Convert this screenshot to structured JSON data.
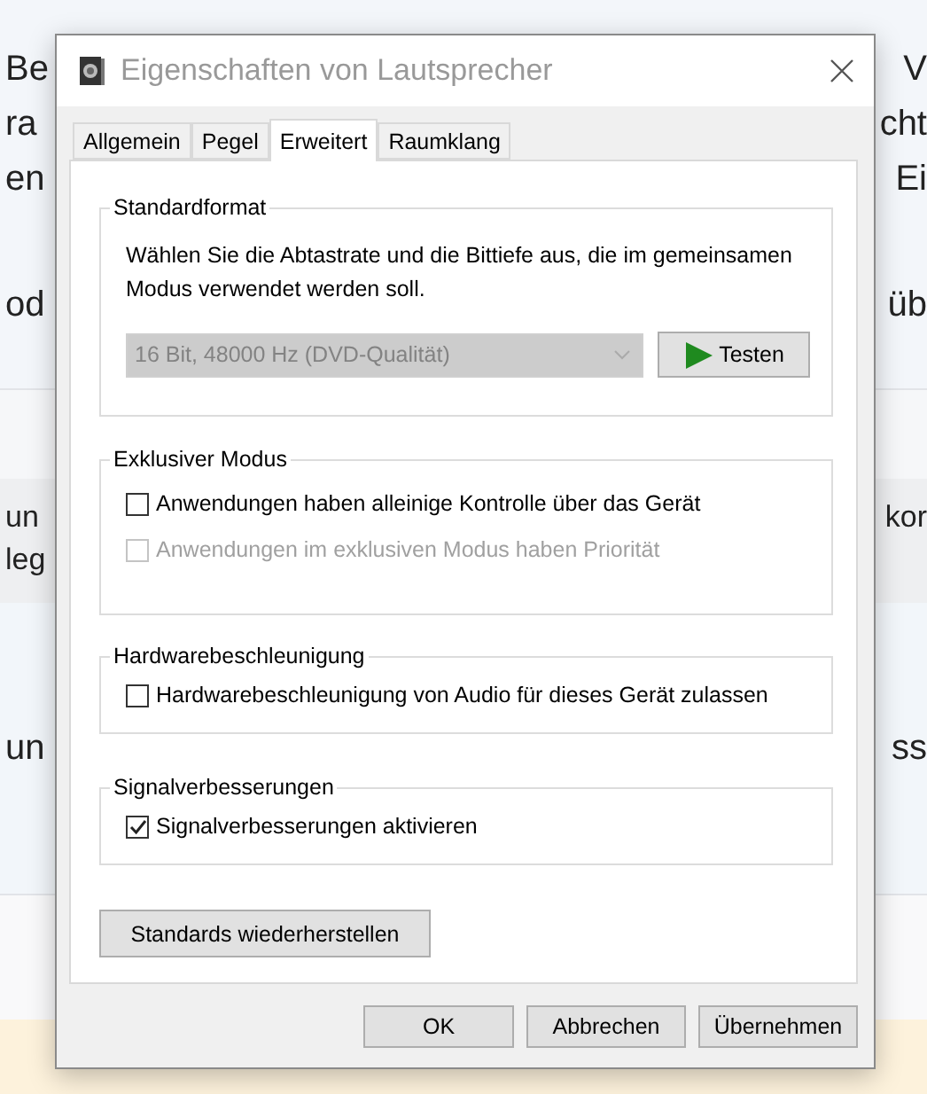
{
  "background": {
    "sections": [
      {
        "kind": "intro",
        "lines": [
          {
            "left": "Be",
            "right": "V"
          },
          {
            "left": "ra",
            "right": "cht"
          },
          {
            "left": "en",
            "right": "Ei"
          }
        ]
      },
      {
        "kind": "intro",
        "lines": [
          {
            "left": "od",
            "right": "üb"
          }
        ]
      },
      {
        "kind": "bar"
      },
      {
        "kind": "highlight",
        "lines": [
          {
            "left": "un",
            "right": "kor"
          },
          {
            "left": "leg"
          }
        ]
      },
      {
        "kind": "body",
        "lines": [
          {
            "left": "un",
            "right": "ss"
          }
        ]
      },
      {
        "kind": "footer"
      },
      {
        "kind": "notice"
      }
    ]
  },
  "window": {
    "title": "Eigenschaften von Lautsprecher"
  },
  "tabs": [
    {
      "label": "Allgemein",
      "selected": false
    },
    {
      "label": "Pegel",
      "selected": false
    },
    {
      "label": "Erweitert",
      "selected": true
    },
    {
      "label": "Raumklang",
      "selected": false
    }
  ],
  "groups": [
    {
      "title": "Standardformat",
      "description": "Wählen Sie die Abtastrate und die Bittiefe aus, die im gemeinsamen Modus verwendet werden soll.",
      "format": {
        "value": "16 Bit, 48000 Hz (DVD-Qualität)",
        "disabled": true
      },
      "test_button": "Testen"
    },
    {
      "title": "Exklusiver Modus",
      "options": [
        {
          "label": "Anwendungen haben alleinige Kontrolle über das Gerät",
          "checked": false,
          "disabled": false
        },
        {
          "label": "Anwendungen im exklusiven Modus haben Priorität",
          "checked": false,
          "disabled": true
        }
      ]
    },
    {
      "title": "Hardwarebeschleunigung",
      "options": [
        {
          "label": "Hardwarebeschleunigung von Audio für dieses Gerät zulassen",
          "checked": false,
          "disabled": false
        }
      ]
    },
    {
      "title": "Signalverbesserungen",
      "options": [
        {
          "label": "Signalverbesserungen aktivieren",
          "checked": true,
          "disabled": false
        }
      ]
    }
  ],
  "restore_button": "Standards wiederherstellen",
  "buttons": [
    "OK",
    "Abbrechen",
    "Übernehmen"
  ]
}
